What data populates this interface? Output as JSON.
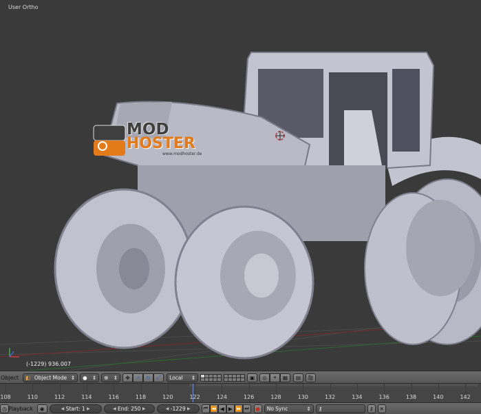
{
  "viewport": {
    "view_label": "User Ortho",
    "cursor_info": "(-1229) 936.007",
    "watermark": {
      "line1": "MOD",
      "line2": "HOSTER",
      "url": "www.modhoster.de"
    }
  },
  "header": {
    "menu_label": "Object",
    "mode": "Object Mode",
    "pivot": "Local"
  },
  "timeline": {
    "ticks": [
      "108",
      "110",
      "112",
      "114",
      "116",
      "118",
      "120",
      "122",
      "124",
      "126",
      "128",
      "130",
      "132",
      "134",
      "136",
      "138",
      "140",
      "142"
    ]
  },
  "playback": {
    "menu_label": "Playback",
    "start": "Start: 1",
    "end": "End: 250",
    "current": "-1229",
    "sync": "No Sync"
  },
  "colors": {
    "accent_orange": "#e37b1b",
    "playhead": "#5c8cff",
    "model": "#c8c8cc"
  }
}
